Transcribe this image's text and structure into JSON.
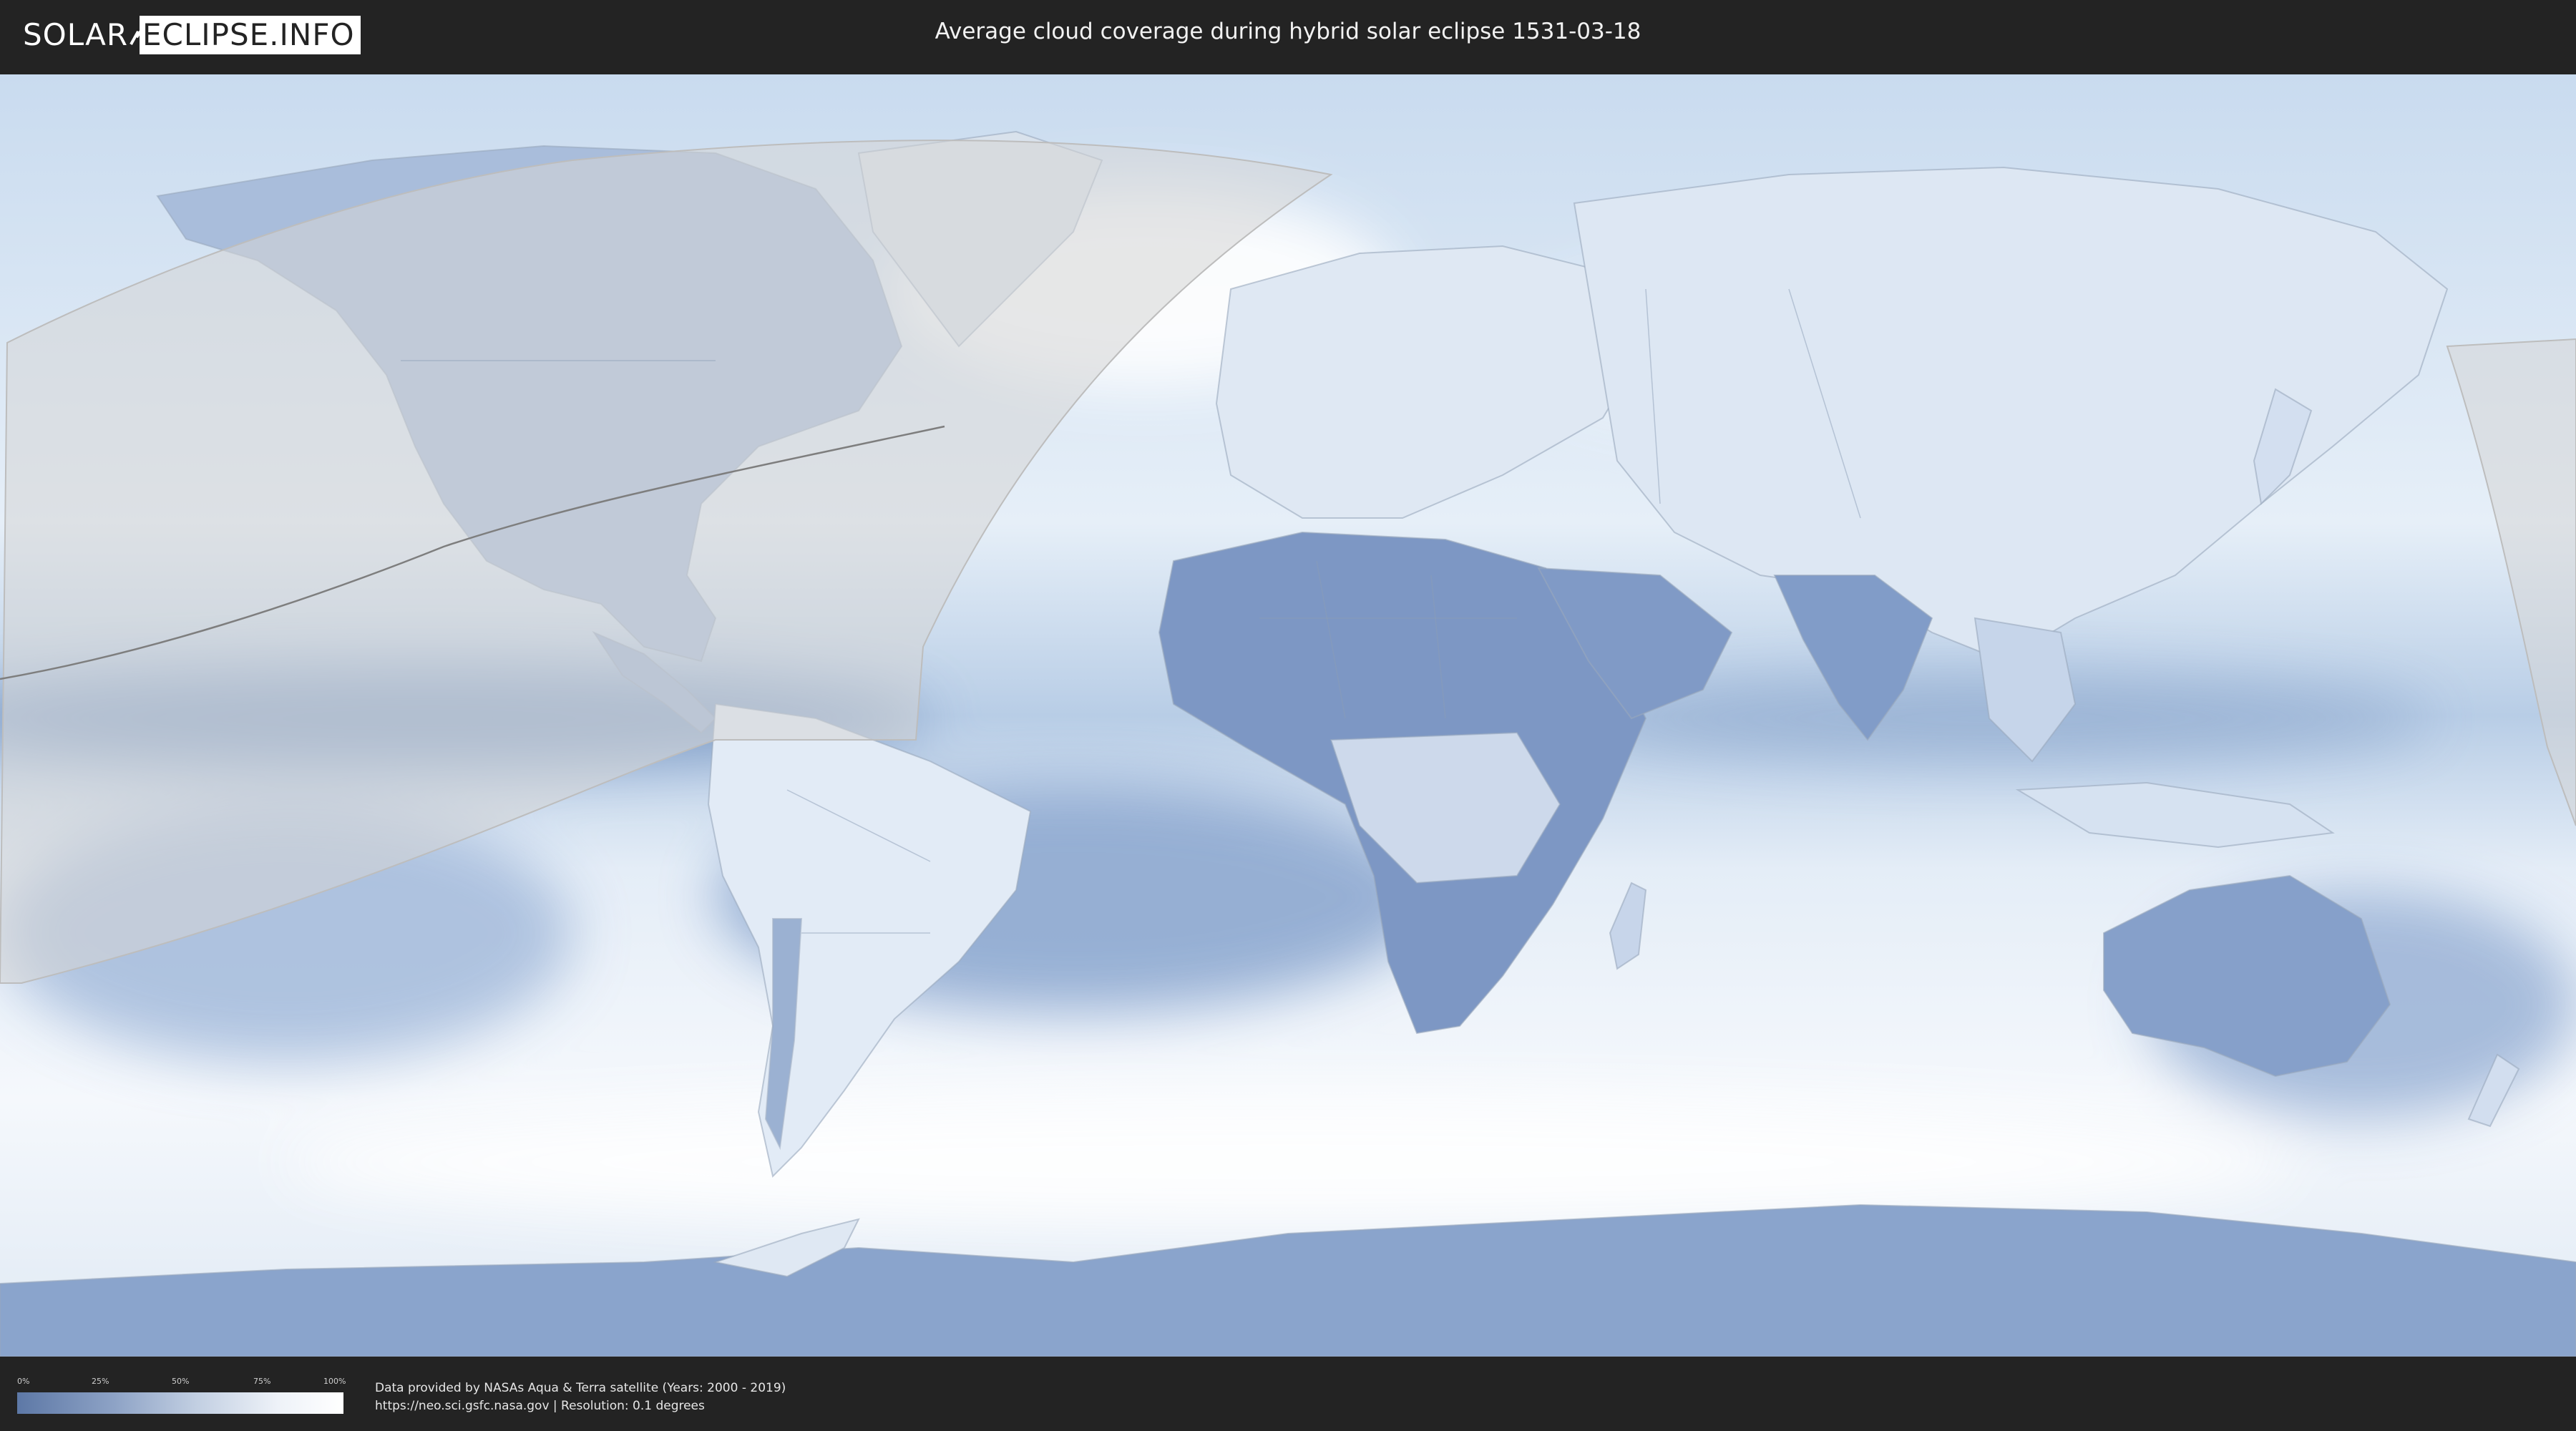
{
  "header": {
    "logo_left": "SOLAR",
    "logo_right": "ECLIPSE.INFO",
    "title": "Average cloud coverage during hybrid solar eclipse 1531-03-18"
  },
  "legend": {
    "ticks": [
      "0%",
      "25%",
      "50%",
      "75%",
      "100%"
    ],
    "tick_fractions": [
      0,
      0.25,
      0.5,
      0.75,
      1.0
    ],
    "gradient_low_color": "#5d78a6",
    "gradient_high_color": "#ffffff"
  },
  "footer": {
    "credit_line": "Data provided by NASAs Aqua & Terra satellite (Years: 2000 - 2019)",
    "source_line": "https://neo.sci.gsfc.nasa.gov | Resolution: 0.1 degrees"
  },
  "map": {
    "projection": "equirectangular",
    "ocean_color": "#cfe0f2",
    "low_cloud_color": "#6a86b6",
    "high_cloud_color": "#f4f8fc",
    "eclipse_shadow_color": "#d8d8d8",
    "icons": [
      "world-map",
      "eclipse-visibility-zone"
    ]
  }
}
